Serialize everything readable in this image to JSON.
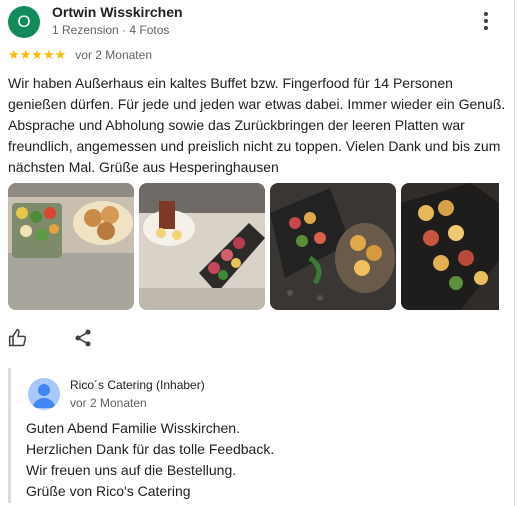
{
  "reviewer": {
    "avatar_letter": "O",
    "avatar_color": "#128a5c",
    "name": "Ortwin Wisskirchen",
    "meta": "1 Rezension · 4 Fotos"
  },
  "rating": {
    "stars_display": "★★★★★",
    "value": 5,
    "max": 5,
    "star_color": "#fbbc04",
    "date": "vor 2 Monaten"
  },
  "review": {
    "text": "Wir haben Außerhaus ein kaltes Buffet bzw. Fingerfood für 14 Personen genießen dürfen. Für jede und jeden war etwas dabei. Immer wieder ein Genuß. Absprache und Abholung sowie das Zurückbringen der leeren Platten war freundlich, angemessen und preislich nicht zu toppen. Vielen Dank und bis zum nächsten Mal. Grüße aus Hesperinghausen"
  },
  "photos": [
    {
      "icon": "food-photo"
    },
    {
      "icon": "food-photo"
    },
    {
      "icon": "food-photo"
    },
    {
      "icon": "food-photo"
    }
  ],
  "actions": {
    "like_icon": "thumbs-up-icon",
    "share_icon": "share-icon"
  },
  "owner_reply": {
    "name": "Rico´s Catering (Inhaber)",
    "date": "vor 2 Monaten",
    "avatar_icon": "person-icon",
    "lines": [
      "Guten Abend Familie Wisskirchen.",
      "Herzlichen Dank für das tolle Feedback.",
      "Wir freuen uns auf die Bestellung.",
      "Grüße von Rico's Catering"
    ]
  }
}
